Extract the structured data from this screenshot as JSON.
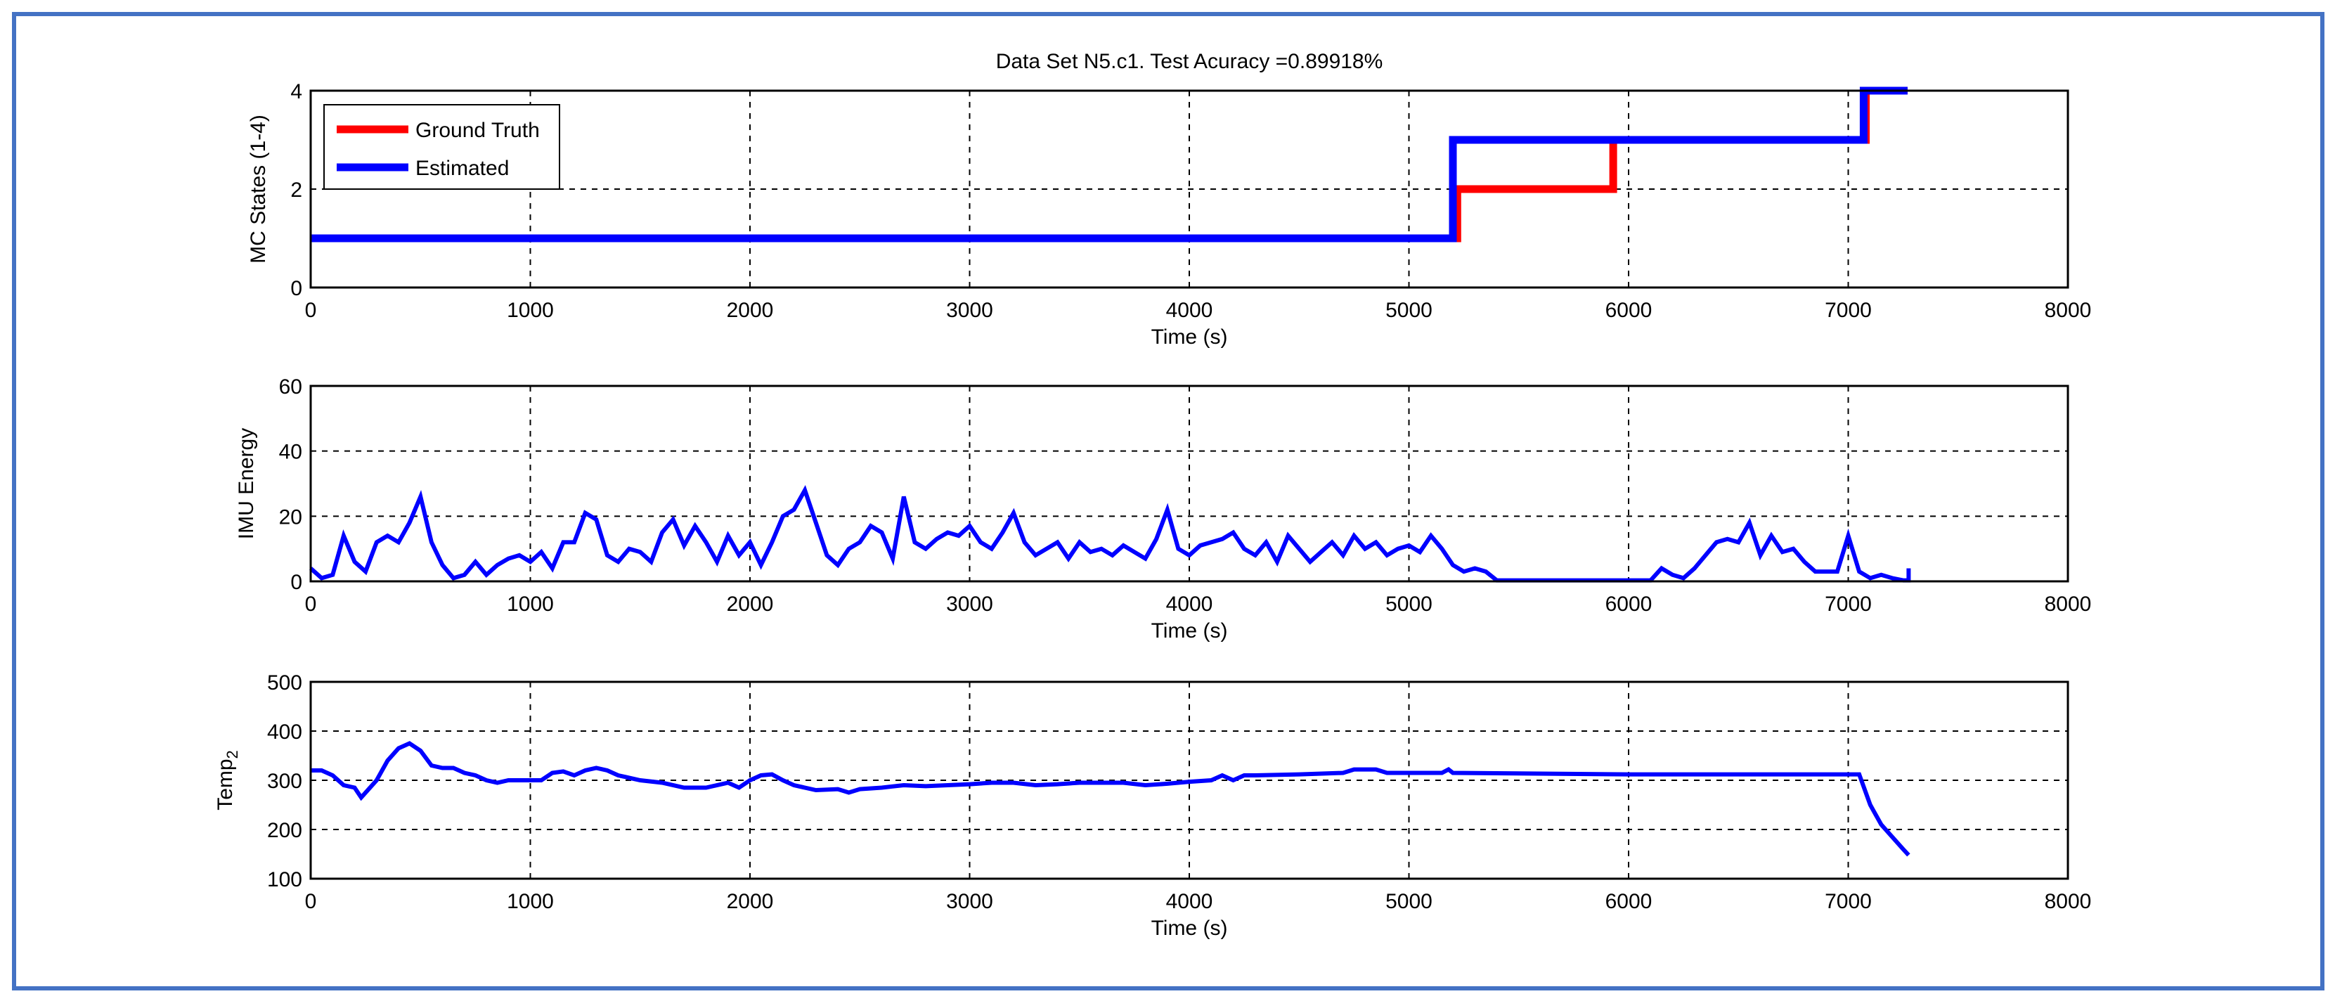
{
  "title": "Data Set N5.c1. Test Acuracy =0.89918%",
  "colors": {
    "frame": "#4472C4",
    "ground_truth": "#FF0000",
    "estimated": "#0000FF",
    "signal": "#0000FF"
  },
  "chart_data": [
    {
      "type": "line",
      "title": "Data Set N5.c1. Test Acuracy =0.89918%",
      "xlabel": "Time (s)",
      "ylabel": "MC States (1-4)",
      "xlim": [
        0,
        8000
      ],
      "ylim": [
        0,
        4
      ],
      "xticks": [
        "0",
        "1000",
        "2000",
        "3000",
        "4000",
        "5000",
        "6000",
        "7000",
        "8000"
      ],
      "yticks": [
        "0",
        "2",
        "4"
      ],
      "ytick_values": [
        0,
        2,
        4
      ],
      "grid": true,
      "legend": {
        "position": "top-left",
        "entries": [
          "Ground Truth",
          "Estimated"
        ]
      },
      "series": [
        {
          "name": "Ground Truth",
          "step": true,
          "x": [
            0,
            5220,
            5220,
            5930,
            5930,
            7080,
            7080,
            7270
          ],
          "y": [
            1,
            1,
            2,
            2,
            3,
            3,
            4,
            4
          ]
        },
        {
          "name": "Estimated",
          "step": true,
          "x": [
            0,
            5200,
            5200,
            7070,
            7070,
            7270
          ],
          "y": [
            1,
            1,
            3,
            3,
            4,
            4
          ]
        }
      ]
    },
    {
      "type": "line",
      "xlabel": "Time (s)",
      "ylabel": "IMU Energy",
      "xlim": [
        0,
        8000
      ],
      "ylim": [
        0,
        60
      ],
      "xticks": [
        "0",
        "1000",
        "2000",
        "3000",
        "4000",
        "5000",
        "6000",
        "7000",
        "8000"
      ],
      "yticks": [
        "0",
        "20",
        "40",
        "60"
      ],
      "ytick_values": [
        0,
        20,
        40,
        60
      ],
      "grid": true,
      "series": [
        {
          "name": "IMU Energy",
          "x_step": 50,
          "y": [
            4,
            1,
            2,
            14,
            6,
            3,
            12,
            14,
            12,
            18,
            26,
            12,
            5,
            1,
            2,
            6,
            2,
            5,
            7,
            8,
            6,
            9,
            4,
            12,
            12,
            21,
            19,
            8,
            6,
            10,
            9,
            6,
            15,
            19,
            11,
            17,
            12,
            6,
            14,
            8,
            12,
            5,
            12,
            20,
            22,
            28,
            18,
            8,
            5,
            10,
            12,
            17,
            15,
            7,
            26,
            12,
            10,
            13,
            15,
            14,
            17,
            12,
            10,
            15,
            21,
            12,
            8,
            10,
            12,
            7,
            12,
            9,
            10,
            8,
            11,
            9,
            7,
            13,
            22,
            10,
            8,
            11,
            12,
            13,
            15,
            10,
            8,
            12,
            6,
            14,
            10,
            6,
            9,
            12,
            8,
            14,
            10,
            12,
            8,
            10,
            11,
            9,
            14,
            10,
            5,
            3,
            4,
            3,
            0.3,
            0.3,
            0.3,
            0.3,
            0.3,
            0.3,
            0.3,
            0.3,
            0.3,
            0.3,
            0.3,
            0.3,
            0.3,
            0.3,
            0.3,
            4,
            2,
            1,
            4,
            8,
            12,
            13,
            12,
            18,
            8,
            14,
            9,
            10,
            6,
            3,
            3,
            3,
            14,
            3,
            1,
            2,
            1,
            0.3,
            0.3,
            0.3,
            0.3,
            4
          ]
        }
      ]
    },
    {
      "type": "line",
      "xlabel": "Time (s)",
      "ylabel": "Temp",
      "ylabel_subscript": "2",
      "xlim": [
        0,
        8000
      ],
      "ylim": [
        100,
        500
      ],
      "xticks": [
        "0",
        "1000",
        "2000",
        "3000",
        "4000",
        "5000",
        "6000",
        "7000",
        "8000"
      ],
      "yticks": [
        "100",
        "200",
        "300",
        "400",
        "500"
      ],
      "ytick_values": [
        100,
        200,
        300,
        400,
        500
      ],
      "grid": true,
      "series": [
        {
          "name": "Temp2",
          "x": [
            0,
            50,
            100,
            150,
            200,
            230,
            300,
            350,
            400,
            450,
            500,
            550,
            600,
            650,
            700,
            750,
            800,
            850,
            900,
            1000,
            1050,
            1100,
            1150,
            1200,
            1250,
            1300,
            1350,
            1400,
            1500,
            1600,
            1700,
            1800,
            1900,
            1950,
            2000,
            2050,
            2100,
            2150,
            2200,
            2300,
            2400,
            2450,
            2500,
            2600,
            2700,
            2800,
            2900,
            3000,
            3100,
            3200,
            3300,
            3400,
            3500,
            3600,
            3700,
            3800,
            3900,
            4000,
            4100,
            4150,
            4200,
            4250,
            4300,
            4500,
            4700,
            4750,
            4850,
            4900,
            5000,
            5150,
            5180,
            5200,
            6000,
            7050,
            7100,
            7150,
            7200,
            7250,
            7275
          ],
          "y": [
            320,
            320,
            310,
            290,
            285,
            265,
            300,
            340,
            365,
            375,
            360,
            330,
            325,
            325,
            315,
            310,
            300,
            295,
            300,
            300,
            300,
            315,
            318,
            310,
            320,
            325,
            320,
            310,
            300,
            295,
            285,
            285,
            295,
            285,
            300,
            310,
            312,
            300,
            290,
            280,
            282,
            275,
            282,
            285,
            290,
            288,
            290,
            292,
            295,
            295,
            290,
            292,
            295,
            295,
            295,
            290,
            293,
            297,
            300,
            310,
            300,
            310,
            310,
            312,
            315,
            322,
            322,
            315,
            315,
            315,
            322,
            315,
            312,
            312,
            250,
            210,
            185,
            160,
            148
          ]
        }
      ]
    }
  ]
}
